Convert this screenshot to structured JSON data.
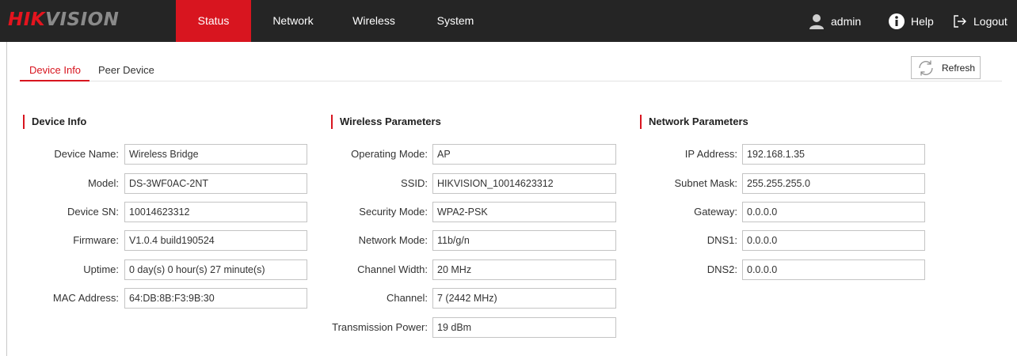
{
  "app": {
    "logo_part1": "HIK",
    "logo_part2": "VISION"
  },
  "nav": {
    "items": [
      {
        "label": "Status",
        "active": true
      },
      {
        "label": "Network",
        "active": false
      },
      {
        "label": "Wireless",
        "active": false
      },
      {
        "label": "System",
        "active": false
      }
    ],
    "user": "admin",
    "help": "Help",
    "logout": "Logout"
  },
  "tabs": [
    {
      "label": "Device Info",
      "active": true
    },
    {
      "label": "Peer Device",
      "active": false
    }
  ],
  "refresh_label": "Refresh",
  "sections": {
    "device": {
      "title": "Device Info",
      "rows": [
        {
          "label": "Device Name:",
          "value": "Wireless Bridge"
        },
        {
          "label": "Model:",
          "value": "DS-3WF0AC-2NT"
        },
        {
          "label": "Device SN:",
          "value": "10014623312"
        },
        {
          "label": "Firmware:",
          "value": "V1.0.4 build190524"
        },
        {
          "label": "Uptime:",
          "value": "0 day(s) 0 hour(s) 27 minute(s)"
        },
        {
          "label": "MAC Address:",
          "value": "64:DB:8B:F3:9B:30"
        }
      ]
    },
    "wireless": {
      "title": "Wireless Parameters",
      "rows": [
        {
          "label": "Operating Mode:",
          "value": "AP"
        },
        {
          "label": "SSID:",
          "value": "HIKVISION_10014623312"
        },
        {
          "label": "Security Mode:",
          "value": "WPA2-PSK"
        },
        {
          "label": "Network Mode:",
          "value": "11b/g/n"
        },
        {
          "label": "Channel Width:",
          "value": "20 MHz"
        },
        {
          "label": "Channel:",
          "value": "7 (2442 MHz)"
        },
        {
          "label": "Transmission Power:",
          "value": "19 dBm"
        }
      ]
    },
    "network": {
      "title": "Network Parameters",
      "rows": [
        {
          "label": "IP Address:",
          "value": "192.168.1.35"
        },
        {
          "label": "Subnet Mask:",
          "value": "255.255.255.0"
        },
        {
          "label": "Gateway:",
          "value": "0.0.0.0"
        },
        {
          "label": "DNS1:",
          "value": "0.0.0.0"
        },
        {
          "label": "DNS2:",
          "value": "0.0.0.0"
        }
      ]
    }
  },
  "icons": {
    "user": "user-icon",
    "help": "info-circle-icon",
    "logout": "logout-arrow-icon",
    "refresh": "refresh-icon"
  },
  "colors": {
    "accent": "#d8151f",
    "topbar": "#252525"
  }
}
